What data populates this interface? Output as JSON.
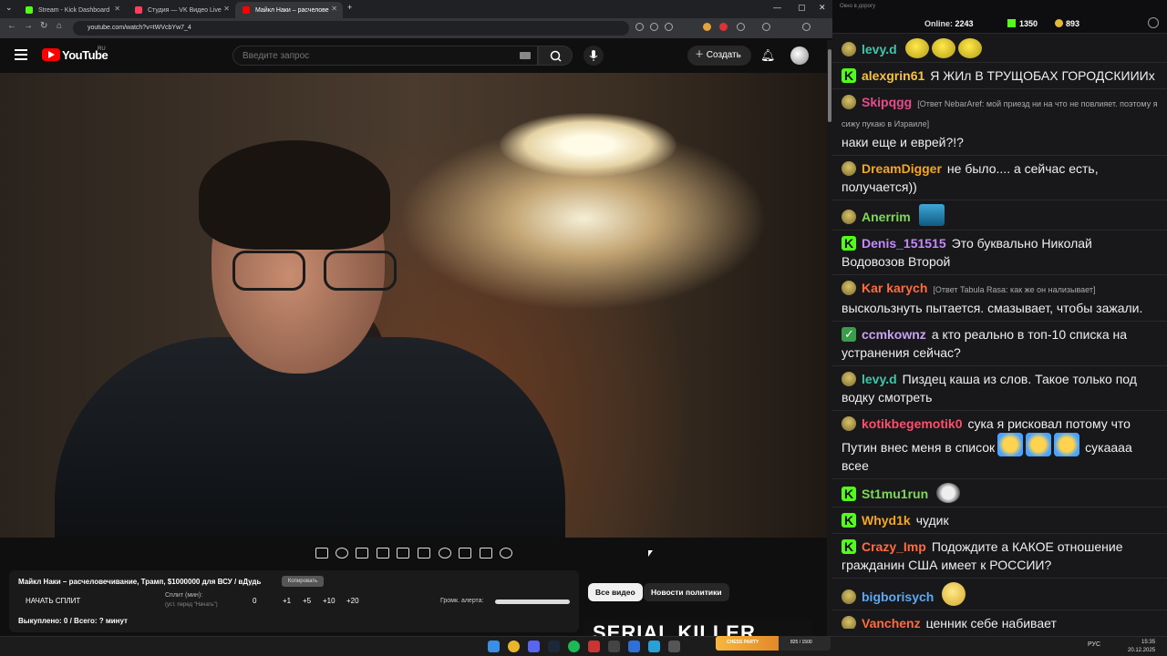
{
  "browser": {
    "tabs": [
      {
        "label": "Stream - Kick Dashboard",
        "active": false,
        "favicon_color": "#53fc18"
      },
      {
        "label": "Студия — VK Видео Live",
        "active": false,
        "favicon_color": "#ff3d5f"
      },
      {
        "label": "Майкл Наки – расчелове",
        "active": true,
        "favicon_color": "#ff0000"
      }
    ],
    "new_tab": "+",
    "url": "youtube.com/watch?v=tWVcbYw7_4"
  },
  "youtube": {
    "logo_text": "YouTube",
    "region": "RU",
    "search_placeholder": "Введите запрос",
    "create_label": "Создать"
  },
  "panel": {
    "video_title": "Майкл Наки – расчеловечивание, Трамп, $1000000 для ВСУ / вДудь",
    "subscribe_label": "Копировать",
    "split_button": "НАЧАТЬ СПЛИТ",
    "split_label": "Сплит (мин):",
    "split_hint": "(уст. перед \"Начать\")",
    "split_value": "0",
    "increments": [
      "+1",
      "+5",
      "+10",
      "+20"
    ],
    "alert_volume_label": "Громк. алерта:",
    "alert_volume": 1.0,
    "bought_text": "Выкуплено: 0 / Всего: ? минут"
  },
  "chips": {
    "all": "Все видео",
    "news": "Новости политики"
  },
  "thumbnail_text": "SERIAL KILLER",
  "chat": {
    "window_title": "Окно в дорогу",
    "online_label": "Online:",
    "online_count": "2243",
    "kick_count": "1350",
    "coin_count": "893",
    "messages": [
      {
        "badge": "pepe",
        "user": "levy.d",
        "color": "#3ec6a8",
        "reply": "",
        "text": "",
        "emotes": [
          "yellow",
          "yellow",
          "yellow"
        ]
      },
      {
        "badge": "kick",
        "user": "alexgrin61",
        "color": "#f6c244",
        "reply": "",
        "text": "Я ЖИл В ТРУЩОБАХ ГОРОДСКИИИх",
        "emotes": []
      },
      {
        "badge": "pepe",
        "user": "Skipqgg",
        "color": "#e84c8a",
        "reply": "[Ответ NebarAref: мой приезд ни на что не повлияет. поэтому я сижу пукаю в Израиле]",
        "text": "наки еще и еврей?!?",
        "emotes": []
      },
      {
        "badge": "pepe",
        "user": "DreamDigger",
        "color": "#f5a623",
        "reply": "",
        "text": "не было.... а сейчас есть, получается))",
        "emotes": []
      },
      {
        "badge": "pepe",
        "user": "Anerrim",
        "color": "#7ed957",
        "reply": "",
        "text": "",
        "emotes": [
          "blue"
        ]
      },
      {
        "badge": "kick",
        "user": "Denis_151515",
        "color": "#c58af9",
        "reply": "",
        "text": "Это буквально Николай Водовозов Второй",
        "emotes": []
      },
      {
        "badge": "pepe",
        "user": "Kar karych",
        "color": "#ff6b3d",
        "reply": "[Ответ Tabula Rasa: как же он нализывает]",
        "text": "выскользнуть пытается. смазывает, чтобы зажали.",
        "emotes": []
      },
      {
        "badge": "check",
        "user": "ccmkownz",
        "color": "#c8a2f0",
        "reply": "",
        "text": "а кто реально в топ-10 списка на устранения сейчас?",
        "emotes": []
      },
      {
        "badge": "pepe",
        "user": "levy.d",
        "color": "#3ec6a8",
        "reply": "",
        "text": "Пиздец каша из слов. Такое только под водку смотреть",
        "emotes": []
      },
      {
        "badge": "pepe",
        "user": "kotikbegemotik0",
        "color": "#ff4d6d",
        "reply": "",
        "text": "сука я рисковал потому что Путин внес меня в список",
        "emotes": [
          "laugh",
          "laugh",
          "laugh"
        ],
        "text_after": "сукаааа всее"
      },
      {
        "badge": "kick",
        "user": "St1mu1run",
        "color": "#7ed957",
        "reply": "",
        "text": "",
        "emotes": [
          "ghost"
        ]
      },
      {
        "badge": "kick",
        "user": "Whyd1k",
        "color": "#f5a623",
        "reply": "",
        "text": "чудик",
        "emotes": []
      },
      {
        "badge": "kick",
        "user": "Crazy_Imp",
        "color": "#ff6b3d",
        "reply": "",
        "text": "Подождите а КАКОЕ отношение гражданин США имеет к РОССИИ?",
        "emotes": []
      },
      {
        "badge": "pepe",
        "user": "bigborisych",
        "color": "#5aa9f2",
        "reply": "",
        "text": "",
        "emotes": [
          "smile"
        ]
      },
      {
        "badge": "pepe",
        "user": "Vanchenz",
        "color": "#ff6b3d",
        "reply": "",
        "text": "ценник себе набивает",
        "emotes": []
      }
    ]
  },
  "taskbar": {
    "widget_label": "CHESS PARTY",
    "widget_count": "825 / 1500",
    "widget_progress": 0.55,
    "lang": "РУС",
    "time": "15:35",
    "date": "20.12.2025"
  },
  "colors": {
    "kick_green": "#53fc18",
    "youtube_red": "#ff0000",
    "chat_bg": "#18181b"
  }
}
